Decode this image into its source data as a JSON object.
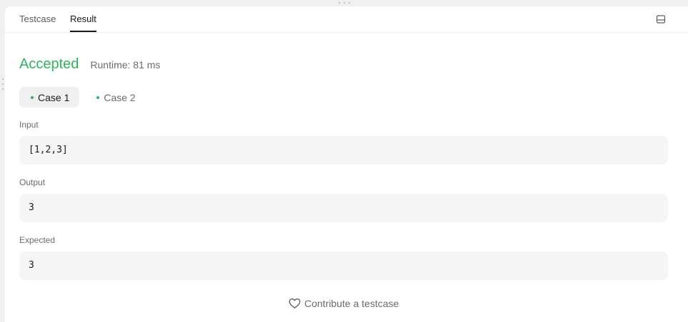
{
  "tabs": [
    {
      "label": "Testcase",
      "active": false
    },
    {
      "label": "Result",
      "active": true
    }
  ],
  "result": {
    "status": "Accepted",
    "runtime": "Runtime: 81 ms"
  },
  "cases": [
    {
      "label": "Case 1",
      "active": true
    },
    {
      "label": "Case 2",
      "active": false
    }
  ],
  "fields": {
    "input": {
      "label": "Input",
      "value": "[1,2,3]"
    },
    "output": {
      "label": "Output",
      "value": "3"
    },
    "expected": {
      "label": "Expected",
      "value": "3"
    }
  },
  "footer": {
    "contribute_label": "Contribute a testcase"
  },
  "colors": {
    "accepted": "#2db55d",
    "case_dot": "#2db55d"
  },
  "icons": {
    "layout": "panel-layout-icon",
    "contribute": "heart-icon"
  }
}
